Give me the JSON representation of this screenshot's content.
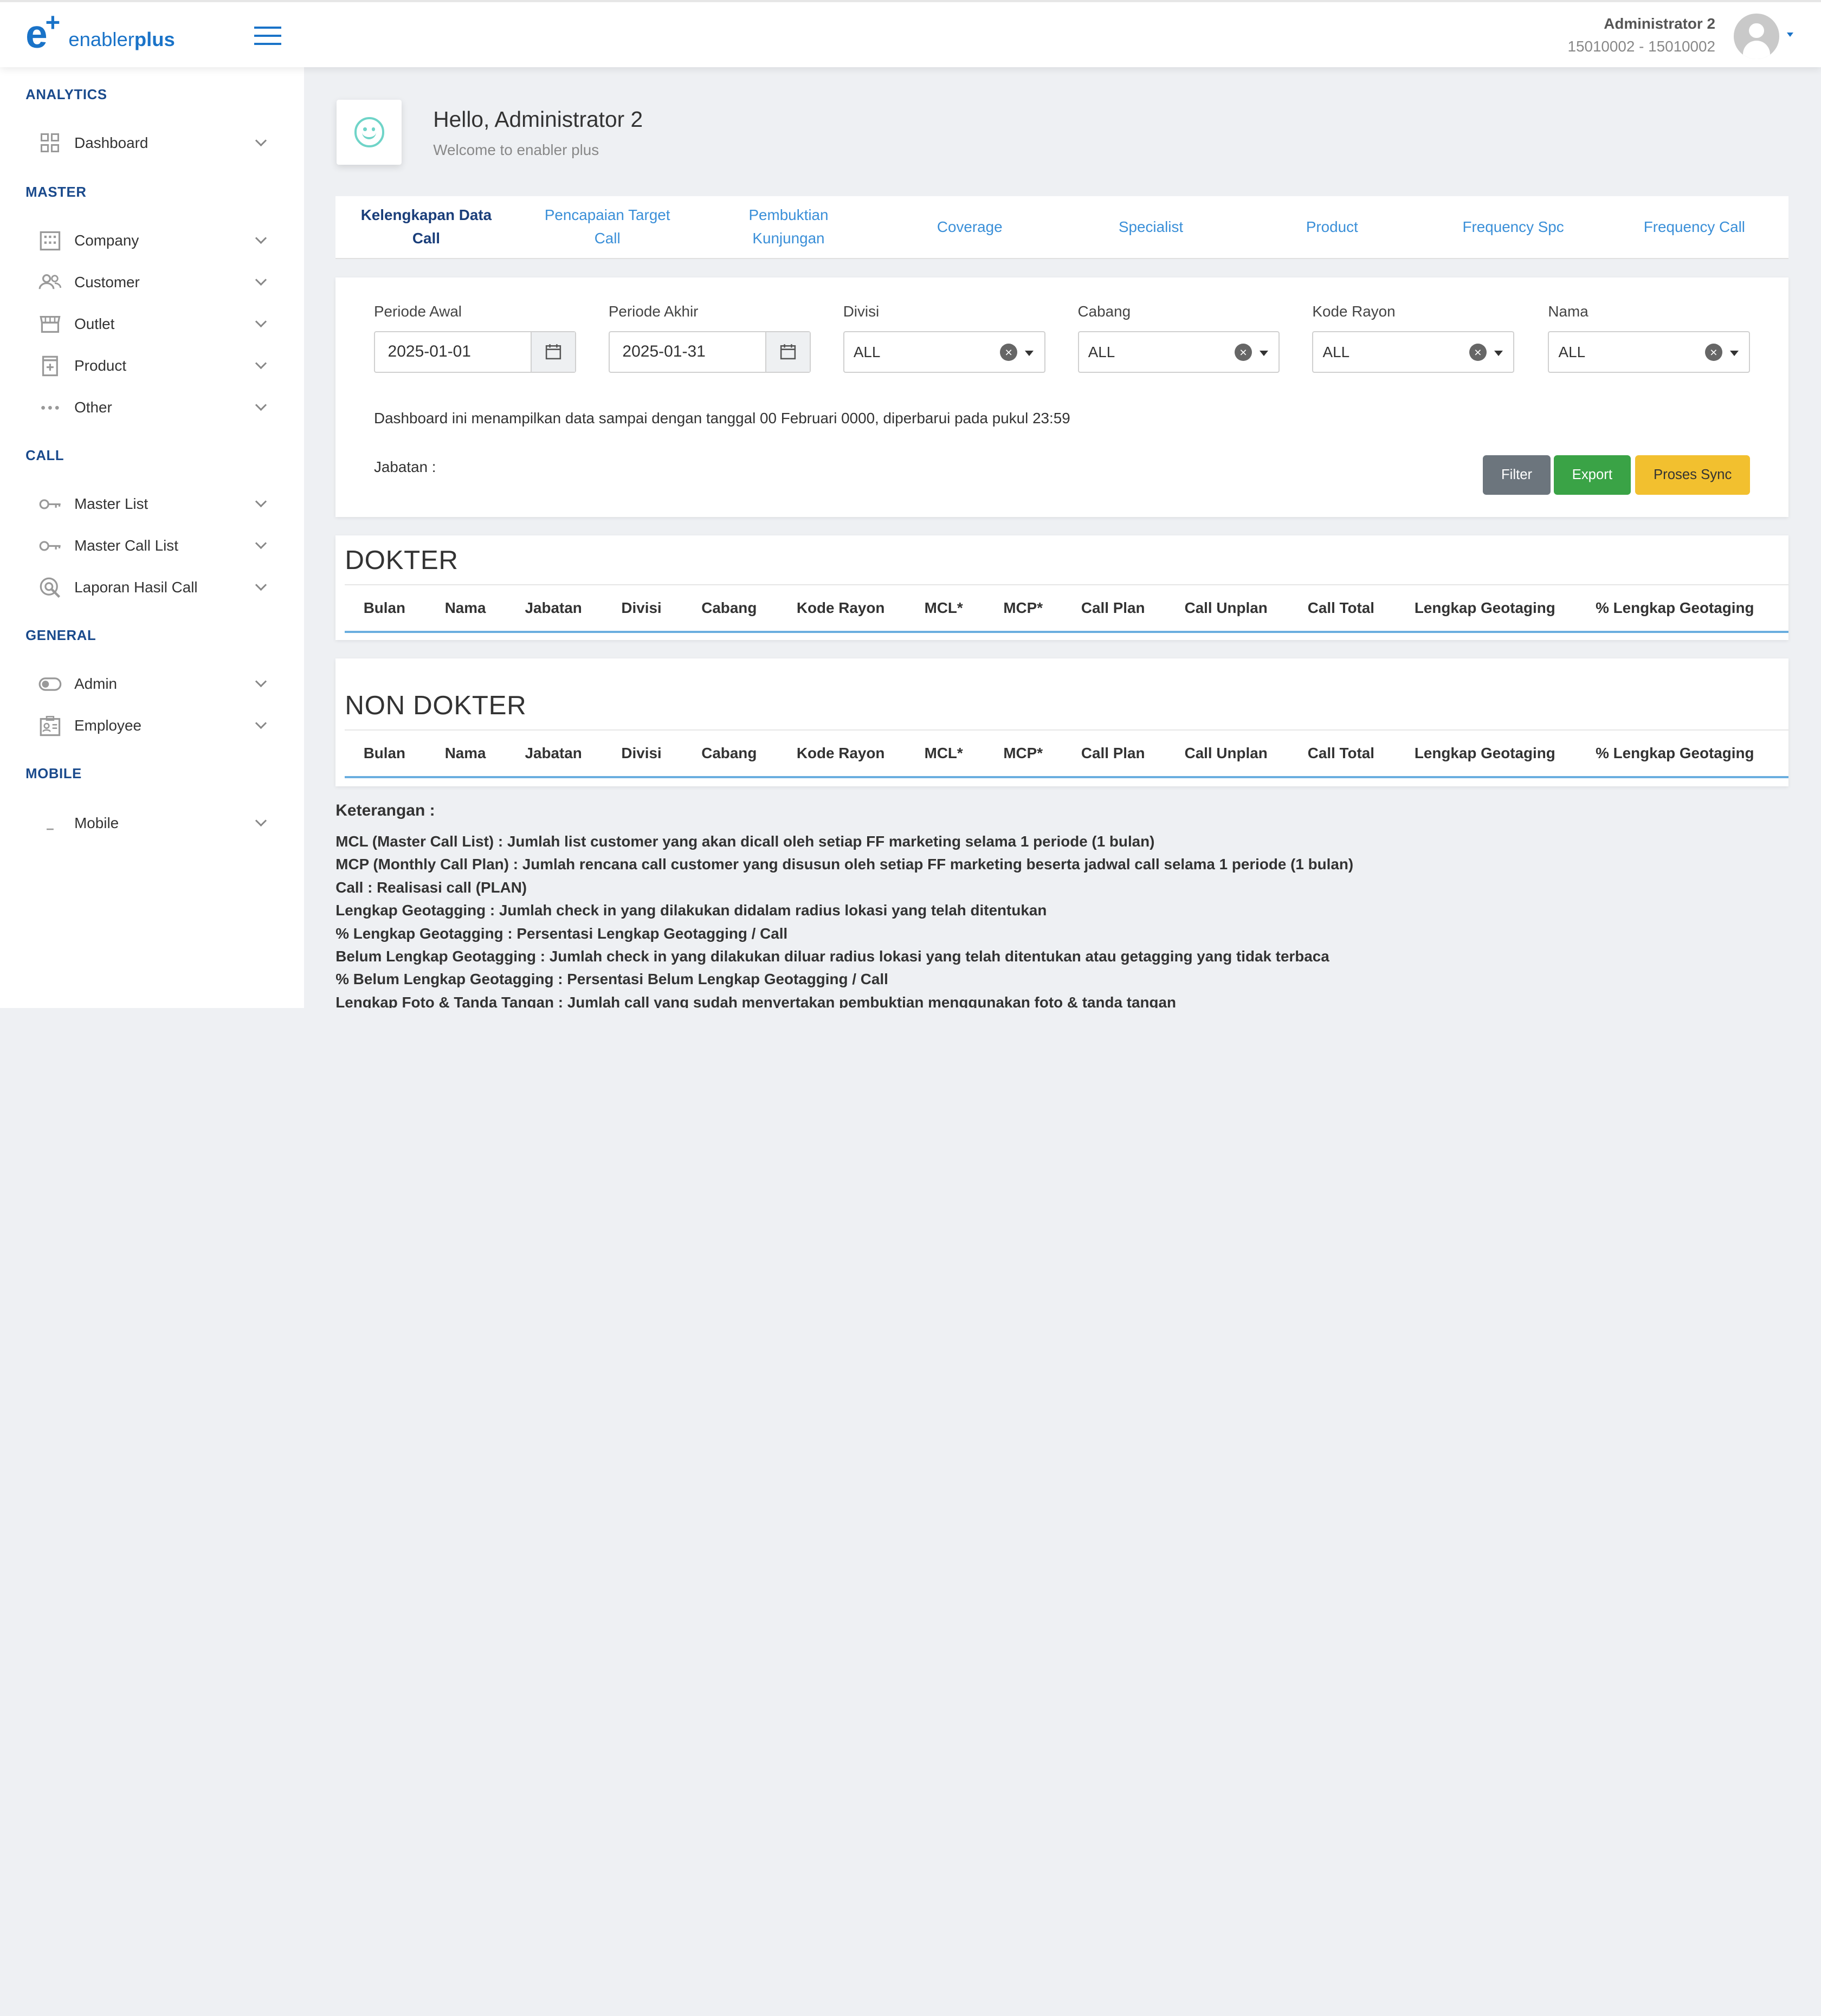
{
  "brand": {
    "name_light": "enabler",
    "name_bold": "plus"
  },
  "user": {
    "name": "Administrator 2",
    "id": "15010002 - 15010002"
  },
  "sidebar": {
    "sections": [
      {
        "title": "ANALYTICS",
        "items": [
          {
            "label": "Dashboard",
            "icon": "dashboard-icon"
          }
        ]
      },
      {
        "title": "MASTER",
        "items": [
          {
            "label": "Company",
            "icon": "building-icon"
          },
          {
            "label": "Customer",
            "icon": "users-icon"
          },
          {
            "label": "Outlet",
            "icon": "store-icon"
          },
          {
            "label": "Product",
            "icon": "product-icon"
          },
          {
            "label": "Other",
            "icon": "more-icon"
          }
        ]
      },
      {
        "title": "CALL",
        "items": [
          {
            "label": "Master List",
            "icon": "key-icon"
          },
          {
            "label": "Master Call List",
            "icon": "key-icon"
          },
          {
            "label": "Laporan Hasil Call",
            "icon": "report-icon"
          }
        ]
      },
      {
        "title": "GENERAL",
        "items": [
          {
            "label": "Admin",
            "icon": "toggle-icon"
          },
          {
            "label": "Employee",
            "icon": "id-card-icon"
          }
        ]
      },
      {
        "title": "MOBILE",
        "items": [
          {
            "label": "Mobile",
            "icon": "mobile-icon"
          }
        ]
      }
    ]
  },
  "welcome": {
    "title": "Hello, Administrator 2",
    "subtitle": "Welcome to enabler plus"
  },
  "tabs": [
    {
      "label": "Kelengkapan Data Call",
      "active": true
    },
    {
      "label": "Pencapaian Target Call",
      "active": false
    },
    {
      "label": "Pembuktian Kunjungan",
      "active": false
    },
    {
      "label": "Coverage",
      "active": false
    },
    {
      "label": "Specialist",
      "active": false
    },
    {
      "label": "Product",
      "active": false
    },
    {
      "label": "Frequency Spc",
      "active": false
    },
    {
      "label": "Frequency Call",
      "active": false
    }
  ],
  "filters": {
    "periode_awal": {
      "label": "Periode Awal",
      "value": "2025-01-01"
    },
    "periode_akhir": {
      "label": "Periode Akhir",
      "value": "2025-01-31"
    },
    "divisi": {
      "label": "Divisi",
      "value": "ALL"
    },
    "cabang": {
      "label": "Cabang",
      "value": "ALL"
    },
    "kode_rayon": {
      "label": "Kode Rayon",
      "value": "ALL"
    },
    "nama": {
      "label": "Nama",
      "value": "ALL"
    },
    "info": "Dashboard ini menampilkan data sampai dengan tanggal 00 Februari 0000, diperbarui pada pukul 23:59",
    "jabatan_label": "Jabatan :",
    "buttons": {
      "filter": "Filter",
      "export": "Export",
      "sync": "Proses Sync"
    }
  },
  "tables": {
    "columns": [
      "Bulan",
      "Nama",
      "Jabatan",
      "Divisi",
      "Cabang",
      "Kode Rayon",
      "MCL*",
      "MCP*",
      "Call Plan",
      "Call Unplan",
      "Call Total",
      "Lengkap Geotaging",
      "% Lengkap Geotaging"
    ],
    "dokter_title": "DOKTER",
    "non_dokter_title": "NON DOKTER"
  },
  "notes": {
    "title": "Keterangan :",
    "lines": [
      "MCL (Master Call List) : Jumlah list customer yang akan dicall oleh setiap FF marketing selama 1 periode (1 bulan)",
      "MCP (Monthly Call Plan) : Jumlah rencana call customer yang disusun oleh setiap FF marketing beserta jadwal call selama 1 periode (1 bulan)",
      "Call : Realisasi call (PLAN)",
      "Lengkap Geotagging : Jumlah check in yang dilakukan didalam radius lokasi yang telah ditentukan",
      "% Lengkap Geotagging : Persentasi Lengkap Geotagging / Call",
      "Belum Lengkap Geotagging : Jumlah check in yang dilakukan diluar radius lokasi yang telah ditentukan atau getagging yang tidak terbaca",
      "% Belum Lengkap Geotagging : Persentasi Belum Lengkap Geotagging / Call",
      "Lengkap Foto & Tanda Tangan : Jumlah call yang sudah menyertakan pembuktian menggunakan foto & tanda tangan"
    ]
  },
  "colors": {
    "accent": "#1a73c8",
    "tab_link": "#3a8fd8",
    "filter_btn": "#6c757d",
    "export_btn": "#3aa346",
    "sync_btn": "#f2c02f"
  }
}
